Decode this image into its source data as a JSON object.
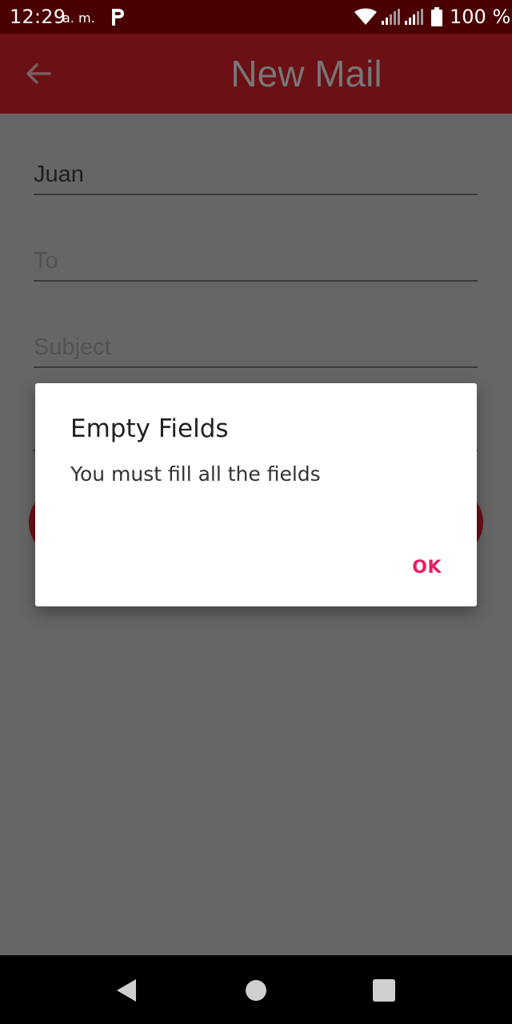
{
  "status_bar": {
    "time": "12:29",
    "ampm": "a. m.",
    "battery": "100 %",
    "icons": [
      "parking-app-icon",
      "wifi-icon",
      "signal-icon",
      "signal-icon",
      "battery-icon"
    ]
  },
  "app_bar": {
    "title": "New Mail",
    "back_icon": "arrow-back-icon"
  },
  "form": {
    "name_value": "Juan",
    "to_placeholder": "To",
    "subject_placeholder": "Subject"
  },
  "dialog": {
    "title": "Empty Fields",
    "message": "You must fill all the fields",
    "ok_label": "OK"
  },
  "nav_bar": {
    "icons": [
      "nav-back-icon",
      "nav-home-icon",
      "nav-recents-icon"
    ]
  },
  "colors": {
    "status_bar": "#4a0000",
    "app_bar": "#6b1015",
    "scrim_background": "#666666",
    "dialog_accent": "#e91e63"
  }
}
